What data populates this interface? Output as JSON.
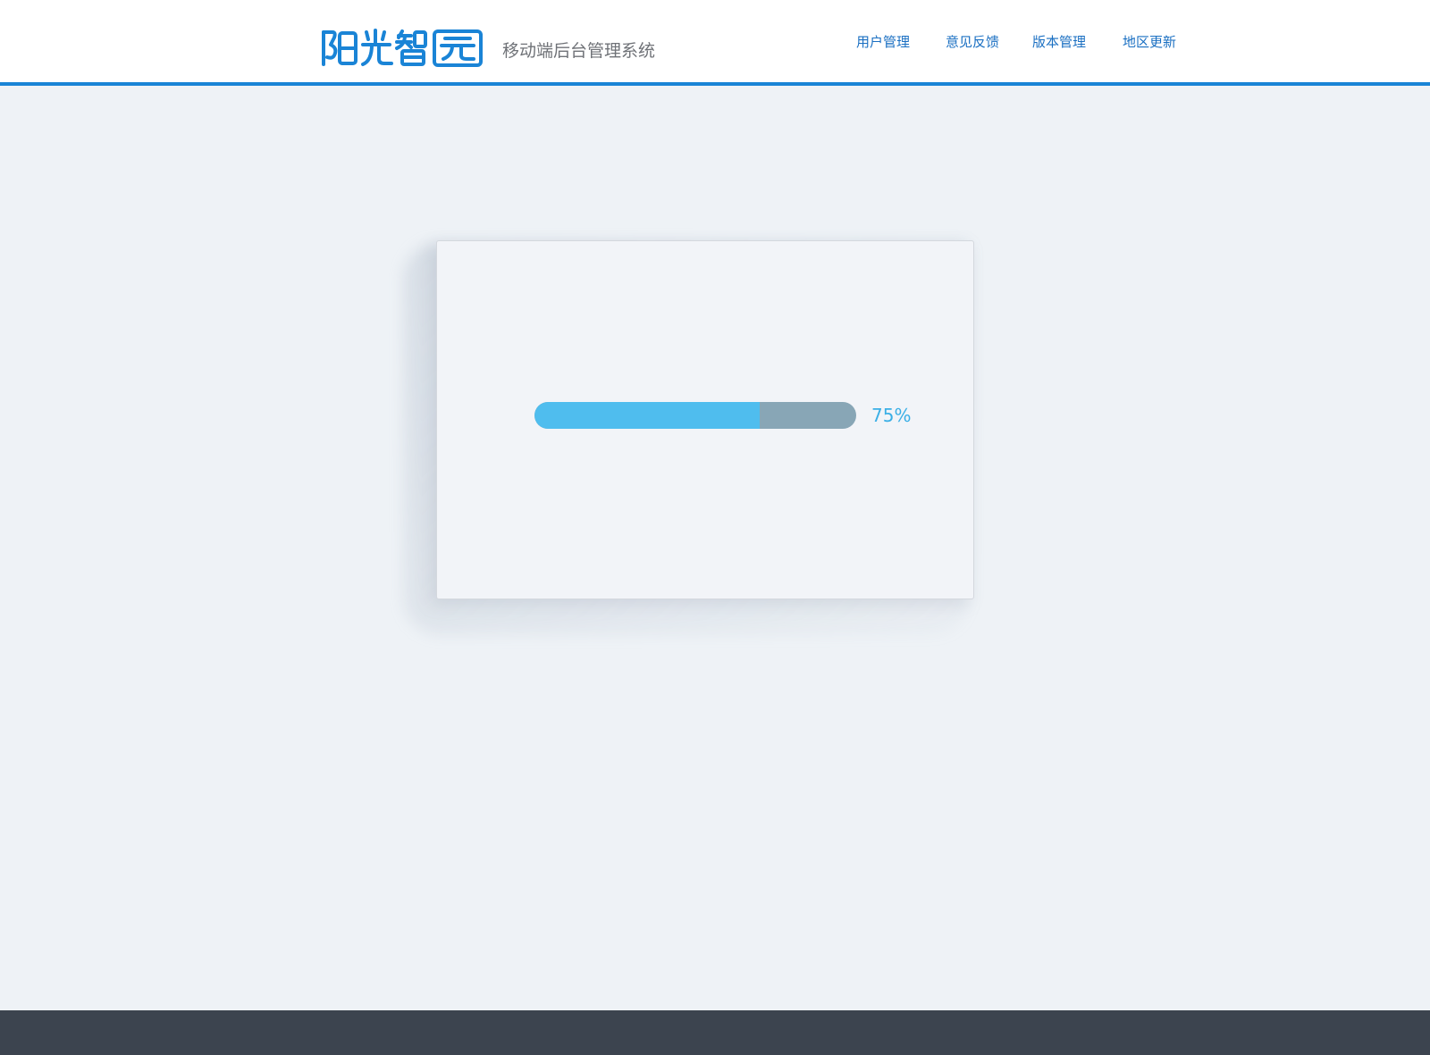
{
  "header": {
    "logo_text": "阳光智园",
    "subtitle": "移动端后台管理系统",
    "nav": [
      {
        "label": "用户管理"
      },
      {
        "label": "意见反馈"
      },
      {
        "label": "版本管理"
      },
      {
        "label": "地区更新"
      }
    ]
  },
  "main": {
    "progress": {
      "fraction": 0.7,
      "label": "75%"
    }
  },
  "colors": {
    "accent": "#1a84d6",
    "progress_fill": "#4fbdee",
    "progress_track": "#88a6b6",
    "footer": "#3c444f"
  },
  "icons": {
    "logo": "brand-logo"
  }
}
